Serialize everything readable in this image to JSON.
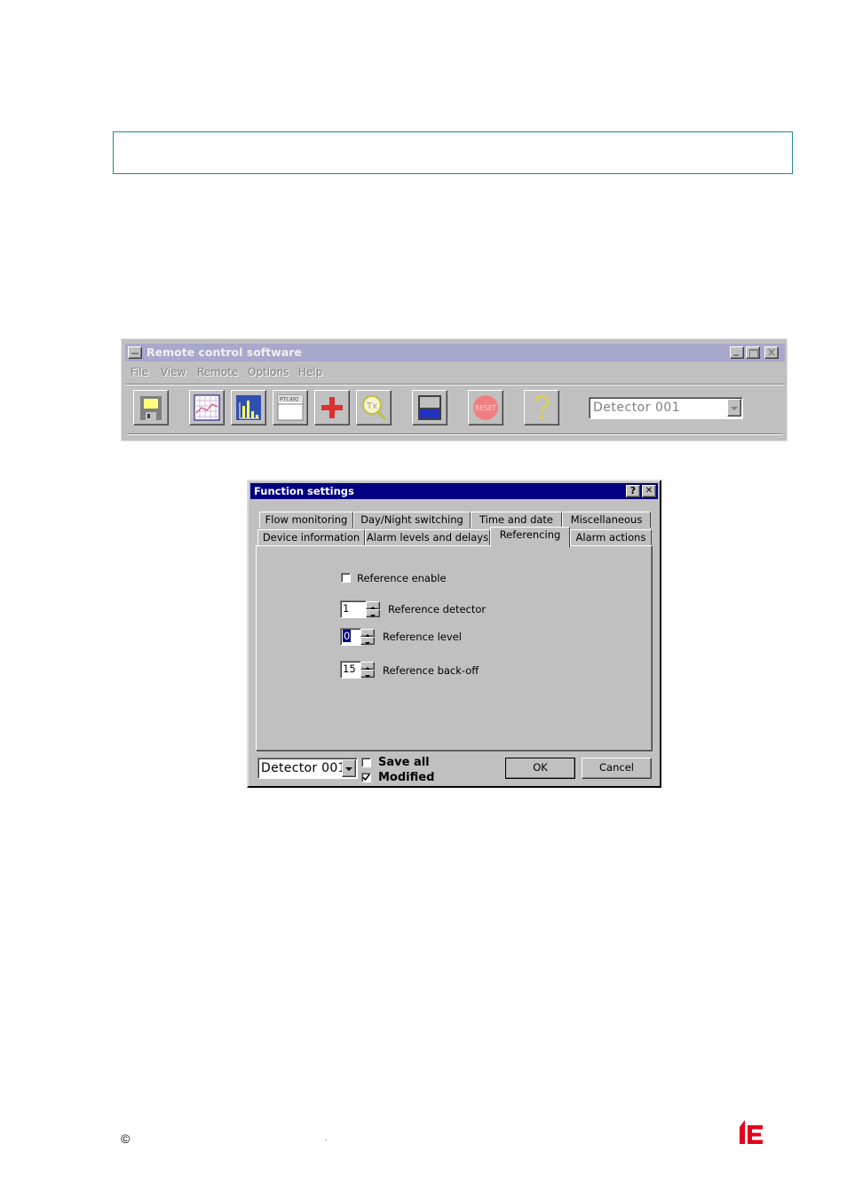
{
  "note_box": {
    "text": ""
  },
  "app_window": {
    "title": "Remote control software",
    "menu": [
      "File",
      "View",
      "Remote",
      "Options",
      "Help"
    ],
    "toolbar": {
      "buttons": [
        "save-icon",
        "grid-chart-icon",
        "histogram-icon",
        "text-view-icon",
        "add-icon",
        "tx-search-icon",
        "window-icon",
        "reset-icon",
        "help-icon"
      ],
      "reset_label": "RESET",
      "tx_label": "Tx",
      "text_view_label": "PTC492"
    },
    "detector_select": "Detector 001"
  },
  "dialog": {
    "title": "Function settings",
    "help_glyph": "?",
    "close_glyph": "✕",
    "tabs_row1": [
      "Flow monitoring",
      "Day/Night switching",
      "Time and date",
      "Miscellaneous"
    ],
    "tabs_row2": [
      "Device information",
      "Alarm levels and delays",
      "Referencing",
      "Alarm actions"
    ],
    "active_tab": "Referencing",
    "reference_enable": {
      "label": "Reference enable",
      "checked": false
    },
    "reference_detector": {
      "label": "Reference detector",
      "value": "1"
    },
    "reference_level": {
      "label": "Reference level",
      "value": "0"
    },
    "reference_backoff": {
      "label": "Reference back-off",
      "value": "15"
    },
    "detector_select": "Detector 001",
    "save_all": {
      "label": "Save all",
      "checked": false
    },
    "modified": {
      "label": "Modified",
      "checked": true
    },
    "ok_label": "OK",
    "cancel_label": "Cancel"
  },
  "footer": {
    "copyright_symbol": "©",
    "dot": "."
  },
  "colors": {
    "box_border": "#1f8a8a",
    "app_title_bar": "#a0a0c8",
    "dialog_title_bar": "#000080",
    "logo_red": "#e3001b"
  }
}
